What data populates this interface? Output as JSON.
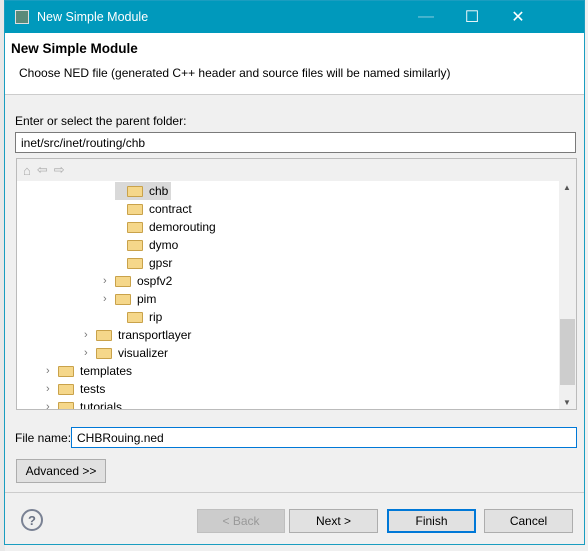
{
  "window": {
    "title": "New Simple Module",
    "minimize": "—",
    "maximize": "☐",
    "close": "✕"
  },
  "header": {
    "title": "New Simple Module",
    "description": "Choose NED file (generated C++ header and source files will be named similarly)"
  },
  "folder": {
    "label": "Enter or select the parent folder:",
    "value": "inet/src/inet/routing/chb"
  },
  "tree": {
    "toolbar": {
      "home": "⌂",
      "back": "⇦",
      "forward": "⇨"
    },
    "items": [
      {
        "label": "chb",
        "expandable": false,
        "selected": true
      },
      {
        "label": "contract",
        "expandable": false
      },
      {
        "label": "demorouting",
        "expandable": false
      },
      {
        "label": "dymo",
        "expandable": false
      },
      {
        "label": "gpsr",
        "expandable": false
      },
      {
        "label": "ospfv2",
        "expandable": true
      },
      {
        "label": "pim",
        "expandable": true
      },
      {
        "label": "rip",
        "expandable": false
      },
      {
        "label": "transportlayer",
        "expandable": true
      },
      {
        "label": "visualizer",
        "expandable": true
      },
      {
        "label": "templates",
        "expandable": true
      },
      {
        "label": "tests",
        "expandable": true
      },
      {
        "label": "tutorials",
        "expandable": true
      }
    ]
  },
  "file": {
    "label": "File name:",
    "value": "CHBRouing.ned"
  },
  "advanced": "Advanced >>",
  "footer": {
    "help": "?",
    "back": "< Back",
    "next": "Next >",
    "finish": "Finish",
    "cancel": "Cancel"
  }
}
